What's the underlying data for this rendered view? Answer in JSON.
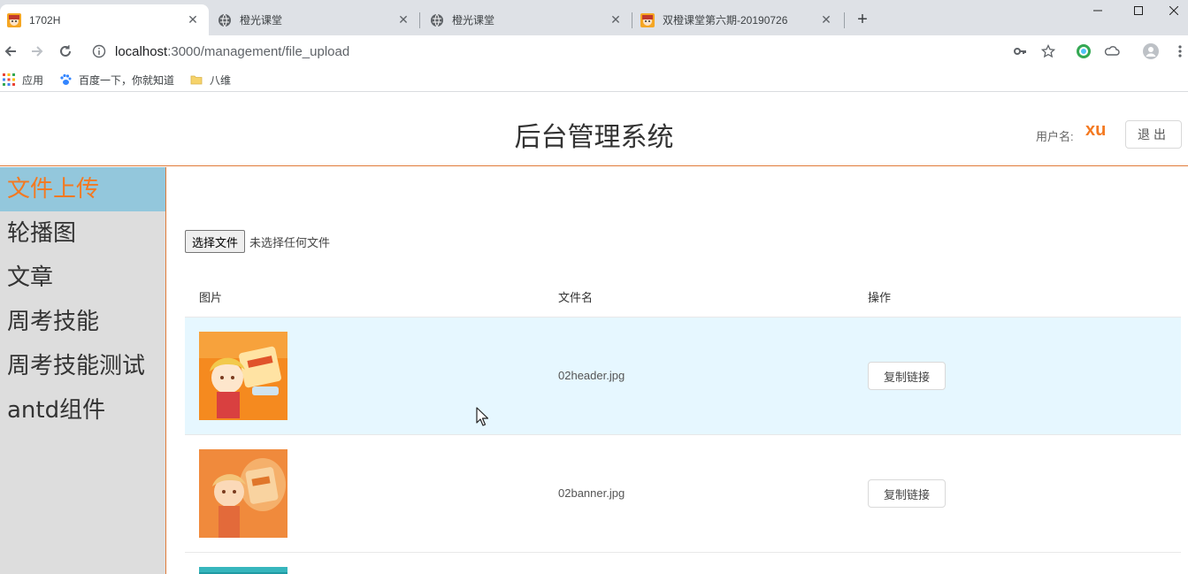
{
  "browser": {
    "tabs": [
      {
        "title": "1702H",
        "active": true,
        "favicon": "anime-avatar-icon"
      },
      {
        "title": "橙光课堂",
        "active": false,
        "favicon": "globe-icon"
      },
      {
        "title": "橙光课堂",
        "active": false,
        "favicon": "globe-icon"
      },
      {
        "title": "双橙课堂第六期-20190726",
        "active": false,
        "favicon": "anime-avatar-icon"
      }
    ],
    "url_host": "localhost",
    "url_path": ":3000/management/file_upload",
    "bookmarks": [
      {
        "label": "应用",
        "icon": "apps-grid-icon"
      },
      {
        "label": "百度一下，你就知道",
        "icon": "baidu-paw-icon"
      },
      {
        "label": "八维",
        "icon": "folder-icon"
      }
    ]
  },
  "header": {
    "title": "后台管理系统",
    "user_label": "用户名:",
    "user_name": "xu",
    "logout_label": "退出"
  },
  "sidebar": {
    "items": [
      {
        "label": "文件上传",
        "active": true
      },
      {
        "label": "轮播图",
        "active": false
      },
      {
        "label": "文章",
        "active": false
      },
      {
        "label": "周考技能",
        "active": false
      },
      {
        "label": "周考技能测试",
        "active": false
      },
      {
        "label": "antd组件",
        "active": false
      }
    ]
  },
  "upload": {
    "button_label": "选择文件",
    "status_text": "未选择任何文件"
  },
  "table": {
    "columns": [
      "图片",
      "文件名",
      "操作"
    ],
    "rows": [
      {
        "file_name": "02header.jpg",
        "action_label": "复制链接"
      },
      {
        "file_name": "02banner.jpg",
        "action_label": "复制链接"
      }
    ]
  },
  "colors": {
    "accent_orange": "#f47920",
    "sidebar_active_bg": "#93c7dc",
    "sidebar_bg": "#dddddd",
    "row_hover_bg": "#e6f7ff"
  }
}
